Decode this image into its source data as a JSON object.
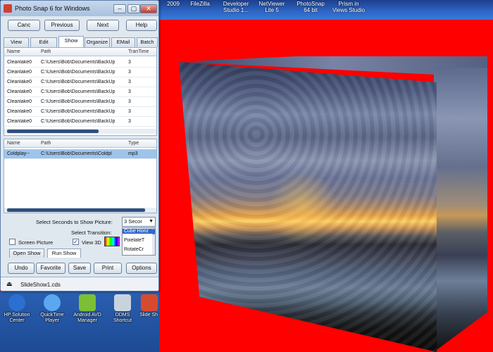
{
  "desktop_top": {
    "labels": [
      "2009",
      "FileZilla",
      "Developer Studio 1...",
      "NetViewer Lite 5",
      "PhotoSnap 64 bit",
      "Prism in Views Studio"
    ]
  },
  "app": {
    "title": "Photo Snap 6 for Windows",
    "window_controls": {
      "minimize": "–",
      "maximize": "▢",
      "close": "✕"
    },
    "nav_buttons": {
      "cancel": "Canc",
      "previous": "Previous",
      "next": "Next",
      "help": "Help"
    },
    "tabs": [
      "View",
      "Edit",
      "Show",
      "Organize",
      "EMail",
      "Batch"
    ],
    "active_tab": "Show",
    "image_list": {
      "columns": [
        "Name",
        "Path",
        "TranTime"
      ],
      "rows": [
        {
          "name": "Cleanlake0",
          "path": "C:\\Users\\Bob\\Documents\\BackUp",
          "time": "3"
        },
        {
          "name": "Cleanlake0",
          "path": "C:\\Users\\Bob\\Documents\\BackUp",
          "time": "3"
        },
        {
          "name": "Cleanlake0",
          "path": "C:\\Users\\Bob\\Documents\\BackUp",
          "time": "3"
        },
        {
          "name": "Cleanlake0",
          "path": "C:\\Users\\Bob\\Documents\\BackUp",
          "time": "3"
        },
        {
          "name": "Cleanlake0",
          "path": "C:\\Users\\Bob\\Documents\\BackUp",
          "time": "3"
        },
        {
          "name": "Cleanlake0",
          "path": "C:\\Users\\Bob\\Documents\\BackUp",
          "time": "3"
        },
        {
          "name": "Cleanlake0",
          "path": "C:\\Users\\Bob\\Documents\\BackUp",
          "time": "3"
        }
      ]
    },
    "music_list": {
      "columns": [
        "Name",
        "Path",
        "Type"
      ],
      "rows": [
        {
          "name": "Coldplay--",
          "path": "C:\\Users\\Bob\\Documents\\Coldpl",
          "type": "mp3"
        }
      ]
    },
    "settings": {
      "seconds_label": "Select Seconds to Show Picture:",
      "seconds_value": "3 Secor",
      "transition_label": "Select Transition:",
      "transitions": [
        "Cube Horiz",
        "PixelateT",
        "RotateCr"
      ],
      "selected_transition": "Cube Horiz",
      "screen_picture_label": "Screen Picture",
      "screen_picture_checked": false,
      "view_3d_label": "View 3D",
      "view_3d_checked": true,
      "open_show_tab": "Open Show",
      "run_show_tab": "Run Show"
    },
    "bottom_buttons": {
      "undo": "Undo",
      "favorite": "Favorite",
      "save": "Save",
      "print": "Print",
      "options": "Options"
    },
    "file_name": "SlideShow1.cds"
  },
  "desktop_icons": [
    {
      "label": "HP Solution Center",
      "icon": "hp-icon",
      "color": "#2b6fd1"
    },
    {
      "label": "QuickTime Player",
      "icon": "quicktime-icon",
      "color": "#5aa9f0"
    },
    {
      "label": "Android AVD Manager",
      "icon": "android-icon",
      "color": "#7bbf35"
    },
    {
      "label": "DDMS Shortcut",
      "icon": "ddms-icon",
      "color": "#c9d3de"
    },
    {
      "label": "Slide Sh",
      "icon": "slideshow-icon",
      "color": "#d84a2e"
    }
  ],
  "colors": {
    "background": "#ff0000",
    "selection": "#9ec4ea",
    "accent": "#3366cc"
  }
}
